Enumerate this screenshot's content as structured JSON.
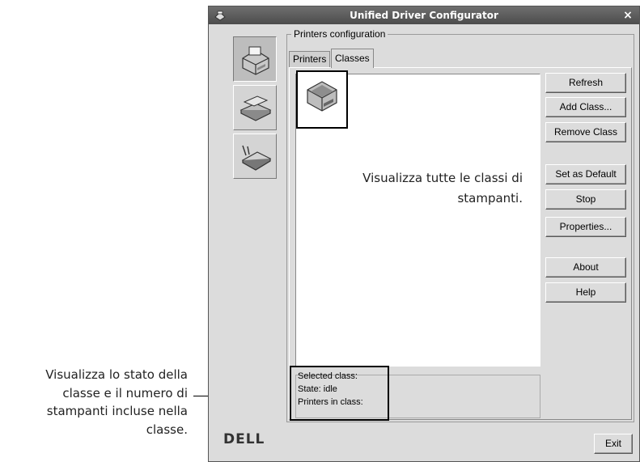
{
  "window": {
    "title": "Unified Driver Configurator",
    "close_glyph": "×"
  },
  "sidebar": {
    "items": [
      {
        "name": "printers",
        "icon": "printer-icon",
        "active": true
      },
      {
        "name": "scanners",
        "icon": "scanner-icon",
        "active": false
      },
      {
        "name": "ports",
        "icon": "port-icon",
        "active": false
      }
    ]
  },
  "main": {
    "group_title": "Printers configuration",
    "tabs": [
      {
        "label": "Printers",
        "active": false
      },
      {
        "label": "Classes",
        "active": true
      }
    ],
    "buttons": {
      "refresh": "Refresh",
      "add_class": "Add Class...",
      "remove_class": "Remove Class",
      "set_default": "Set as Default",
      "stop": "Stop",
      "properties": "Properties...",
      "about": "About",
      "help": "Help"
    },
    "info": {
      "selected_class": "Selected class:",
      "state": "State: idle",
      "printers_in_class": "Printers in class:"
    }
  },
  "footer": {
    "logo": "DELL",
    "exit": "Exit"
  },
  "annotations": {
    "list_note": [
      "Visualizza tutte le classi di",
      "stampanti."
    ],
    "status_note": [
      "Visualizza lo stato della",
      "classe e il numero di",
      "stampanti incluse nella",
      "classe."
    ]
  }
}
